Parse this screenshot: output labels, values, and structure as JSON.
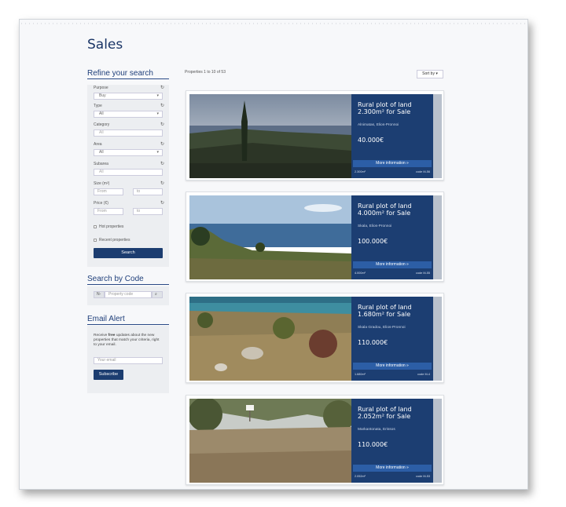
{
  "page": {
    "title": "Sales"
  },
  "refine": {
    "heading": "Refine your search",
    "purpose_label": "Purpose",
    "purpose_value": "Buy",
    "type_label": "Type",
    "type_value": "All",
    "category_label": "Category",
    "category_value": "All",
    "area_label": "Area",
    "area_value": "All",
    "subarea_label": "Subarea",
    "subarea_value": "All",
    "size_label": "Size (m²)",
    "size_from": "From",
    "size_to": "to",
    "price_label": "Price (€)",
    "price_from": "From",
    "price_to": "to",
    "hot_label": "Hot properties",
    "recent_label": "Recent properties",
    "search_button": "Search"
  },
  "code_search": {
    "heading": "Search by Code",
    "prefix": "N-",
    "placeholder": "Property code"
  },
  "email_alert": {
    "heading": "Email Alert",
    "text_pre": "Receive ",
    "text_bold": "free",
    "text_post": " updates about the new properties that match your criteria, right to your email.",
    "email_placeholder": "Your email",
    "subscribe_button": "Subscribe"
  },
  "results": {
    "count_text": "Properties 1 to 10 of 53",
    "sort_label": "Sort by ▾",
    "more_label": "More information »",
    "items": [
      {
        "title": "Rural plot of land 2.300m² for Sale",
        "location": "Alnimatas, Elios-Pronnoi",
        "price": "40.000€",
        "size": "2.300m²",
        "code": "code M-56"
      },
      {
        "title": "Rural plot of land 4.000m² for Sale",
        "location": "Skala, Elios-Pronnoi",
        "price": "100.000€",
        "size": "4.000m²",
        "code": "code M-55"
      },
      {
        "title": "Rural plot of land 1.680m² for Sale",
        "location": "Skala Gradou, Elios-Pronnoi",
        "price": "110.000€",
        "size": "1.680m²",
        "code": "code M-4"
      },
      {
        "title": "Rural plot of land 2.052m² for Sale",
        "location": "Markantonata, Erissos",
        "price": "110.000€",
        "size": "2.052m²",
        "code": "code M-53"
      }
    ]
  },
  "colors": {
    "brand": "#1c3e72",
    "accent": "#2c5ea6"
  }
}
